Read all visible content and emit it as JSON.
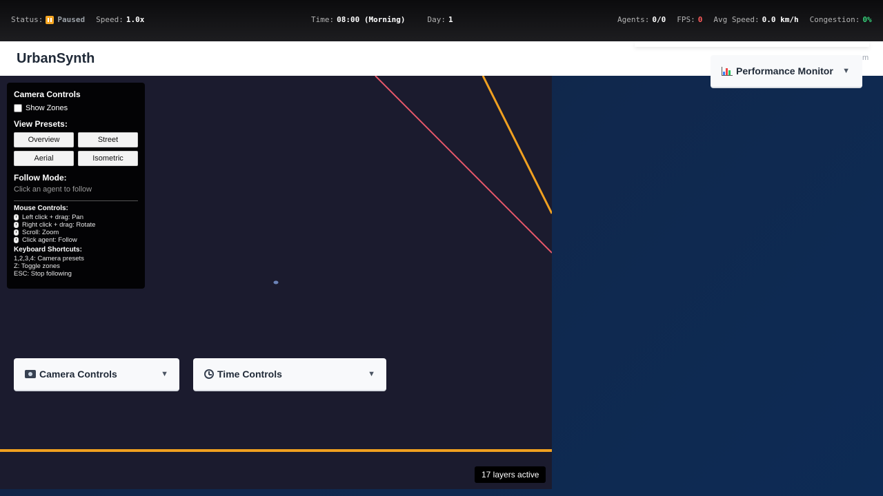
{
  "status_bar": {
    "status_label": "Status:",
    "status_value": "Paused",
    "speed_label": "Speed:",
    "speed_value": "1.0x",
    "time_label": "Time:",
    "time_value": "08:00 (Morning)",
    "day_label": "Day:",
    "day_value": "1",
    "agents_label": "Agents:",
    "agents_value": "0/0",
    "fps_label": "FPS:",
    "fps_value": "0",
    "avg_speed_label": "Avg Speed:",
    "avg_speed_value": "0.0 km/h",
    "congestion_label": "Congestion:",
    "congestion_value": "0%",
    "colors": {
      "paused": "#f5a623",
      "fps": "#ff5b5b",
      "congestion": "#36d17a"
    }
  },
  "header": {
    "title": "UrbanSynth",
    "clipped_text": "m"
  },
  "camera_panel": {
    "title": "Camera Controls",
    "show_zones_label": "Show Zones",
    "show_zones_checked": false,
    "presets_title": "View Presets:",
    "presets": [
      "Overview",
      "Street",
      "Aerial",
      "Isometric"
    ],
    "follow_title": "Follow Mode:",
    "follow_hint": "Click an agent to follow",
    "mouse_title": "Mouse Controls:",
    "mouse_controls": [
      "Left click + drag: Pan",
      "Right click + drag: Rotate",
      "Scroll: Zoom",
      "Click agent: Follow"
    ],
    "keyboard_title": "Keyboard Shortcuts:",
    "keyboard_shortcuts": [
      "1,2,3,4: Camera presets",
      "Z: Toggle zones",
      "ESC: Stop following"
    ]
  },
  "cards": {
    "performance": {
      "label": "Performance Monitor",
      "icon": "bar-chart-icon"
    },
    "camera": {
      "label": "Camera Controls",
      "icon": "camera-icon"
    },
    "time": {
      "label": "Time Controls",
      "icon": "stopwatch-icon"
    }
  },
  "viewport": {
    "layers_badge": "17 layers active",
    "road_colors": {
      "red": "#e8586a",
      "orange": "#f0a020"
    }
  }
}
